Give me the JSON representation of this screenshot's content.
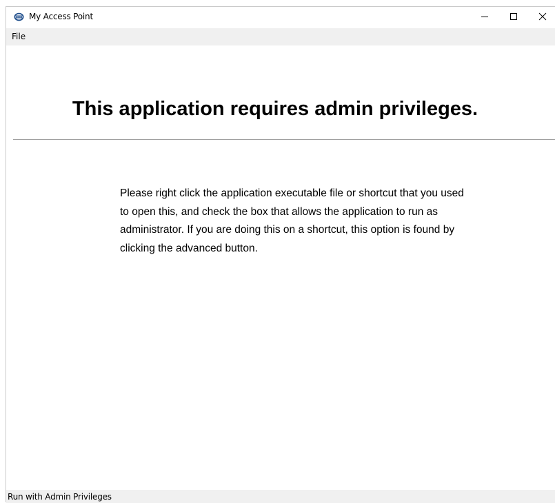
{
  "window": {
    "title": "My Access Point",
    "icon": "app-logo-icon",
    "controls": {
      "minimize_icon": "minimize-icon",
      "maximize_icon": "maximize-icon",
      "close_icon": "close-icon"
    }
  },
  "menubar": {
    "items": [
      {
        "label": "File"
      }
    ]
  },
  "main": {
    "heading": "This application requires admin privileges.",
    "message": "Please right click the application executable file or shortcut that you used to open this, and check the box that allows the application to run as administrator. If you are doing this on a shortcut, this option is found by clicking the advanced button."
  },
  "statusbar": {
    "text": "Run with Admin Privileges"
  },
  "colors": {
    "menubar_bg": "#f0f0f0",
    "statusbar_bg": "#f0f0f0",
    "divider": "#a0a0a0",
    "icon_accent": "#1f4e8c"
  }
}
